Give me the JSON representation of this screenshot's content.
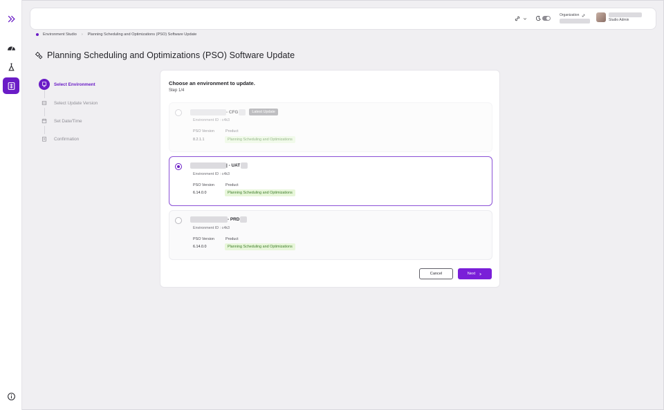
{
  "rail": {
    "items": [
      {
        "name": "expand-icon"
      },
      {
        "name": "dashboard-gauge-icon"
      },
      {
        "name": "flask-icon"
      },
      {
        "name": "environment-studio-icon",
        "active": true
      },
      {
        "name": "info-icon"
      }
    ]
  },
  "header": {
    "organization_label": "Organization",
    "user_role": "Studio Admin"
  },
  "breadcrumb": {
    "root": "Environment Studio",
    "current": "Planning Scheduling and Optimizations (PSO) Software Update"
  },
  "page": {
    "title": "Planning Scheduling and Optimizations (PSO) Software Update"
  },
  "stepper": {
    "steps": [
      {
        "label": "Select Environment",
        "active": true
      },
      {
        "label": "Select Update Version",
        "active": false
      },
      {
        "label": "Set Date/Time",
        "active": false
      },
      {
        "label": "Confirmation",
        "active": false
      }
    ]
  },
  "card": {
    "heading": "Choose an environment to update.",
    "step_text": "Step 1/4",
    "env_id_prefix": "Environment ID : ",
    "version_label": "PSO Version",
    "product_label": "Product",
    "environments": [
      {
        "suffix": "- CFG",
        "badge": "Latest Update",
        "env_id": "Environment ID : c4k3",
        "version": "8.2.1.1",
        "product": "Planning Scheduling and Optimizations",
        "state": "disabled"
      },
      {
        "suffix": "| - UAT",
        "badge": "",
        "env_id": "Environment ID : c4k3",
        "version": "6.14.0.0",
        "product": "Planning Scheduling and Optimizations",
        "state": "selected"
      },
      {
        "suffix": "- PRD",
        "badge": "",
        "env_id": "Environment ID : c4k3",
        "version": "6.14.0.0",
        "product": "Planning Scheduling and Optimizations",
        "state": "default"
      }
    ],
    "cancel_label": "Cancel",
    "next_label": "Next"
  },
  "colors": {
    "accent": "#6a1cc6",
    "next_button": "#7a1fd8",
    "product_tag_bg": "#e7f6d9",
    "product_tag_text": "#3e7d2a"
  }
}
